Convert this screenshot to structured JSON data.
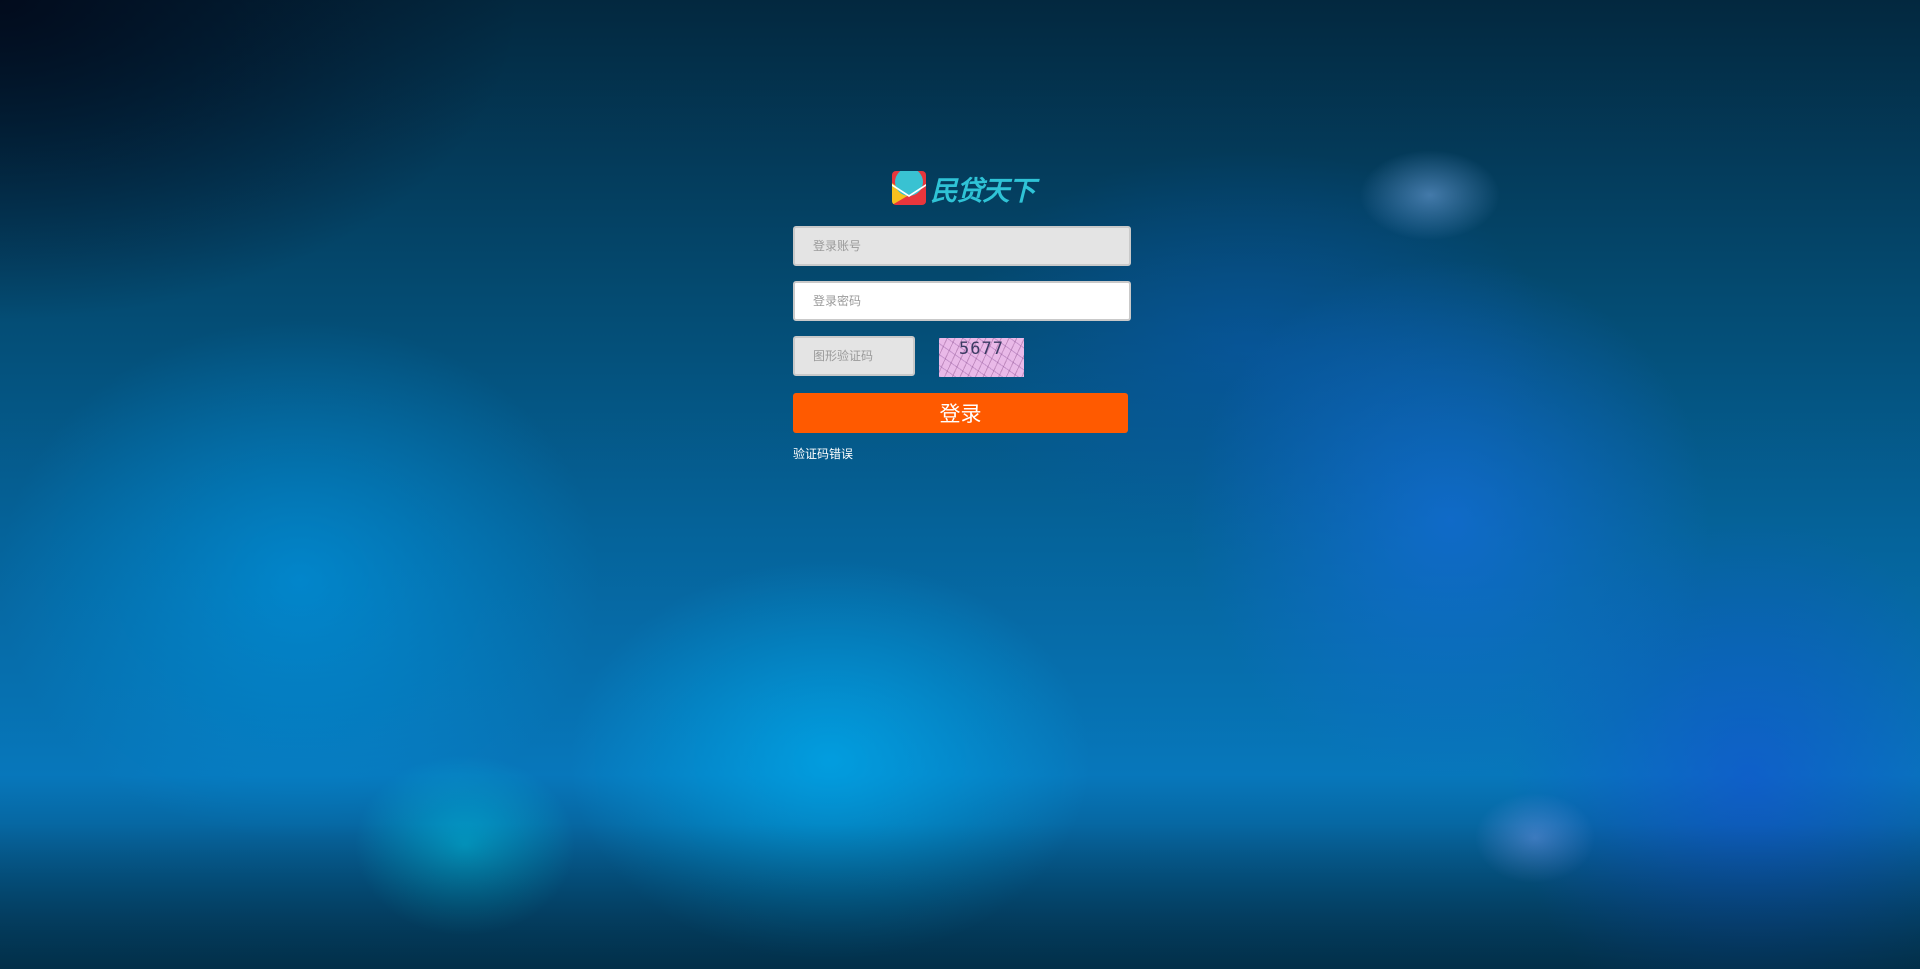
{
  "brand": {
    "logo_icon": "minxiu-logo-icon",
    "name": "民贷天下",
    "color": "#2fc3d6"
  },
  "form": {
    "account_placeholder": "登录账号",
    "password_placeholder": "登录密码",
    "captcha_placeholder": "图形验证码",
    "captcha_image_text": "5677",
    "submit_label": "登录",
    "submit_color": "#ff5a00",
    "error_message": "验证码错误"
  }
}
